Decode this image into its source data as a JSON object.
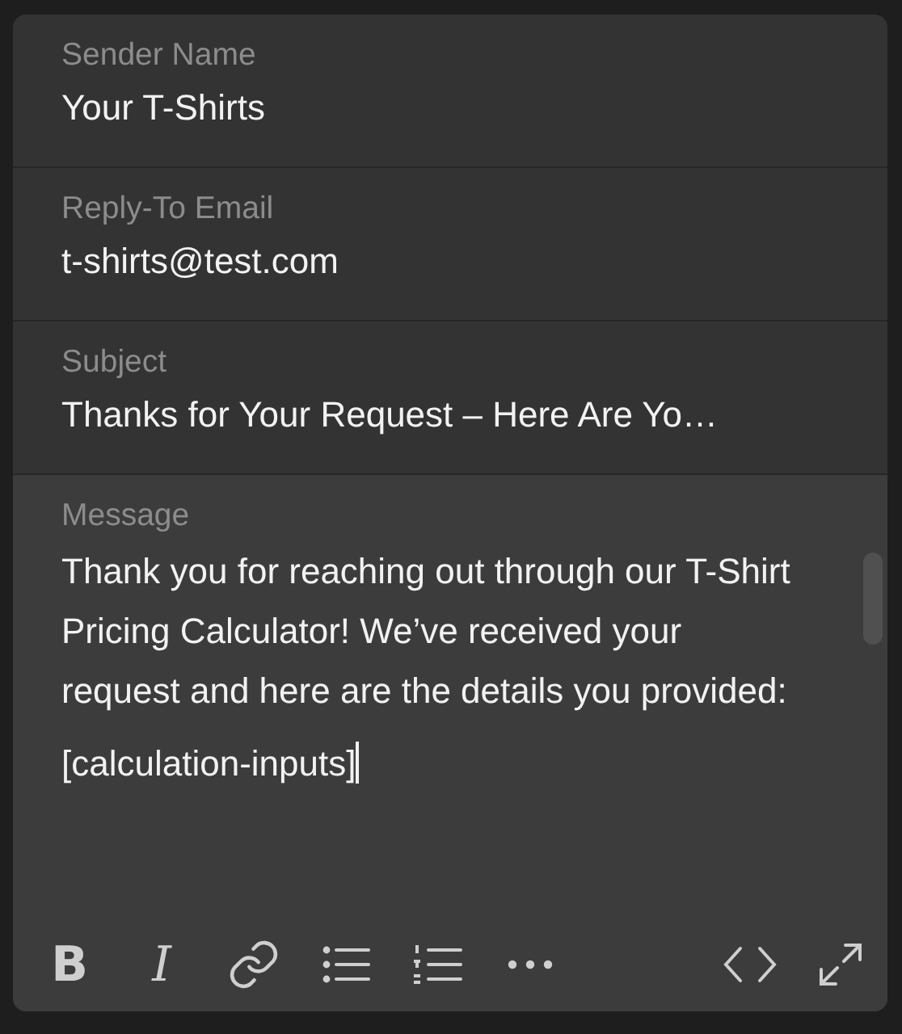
{
  "fields": [
    {
      "label": "Sender Name",
      "value": "Your T-Shirts"
    },
    {
      "label": "Reply-To Email",
      "value": "t-shirts@test.com"
    },
    {
      "label": "Subject",
      "value": "Thanks for Your Request – Here Are Yo…"
    }
  ],
  "message": {
    "label": "Message",
    "paragraphs": [
      "Thank you for reaching out through our T-Shirt Pricing Calculator! We’ve received your request and here are the details you provided:",
      "[calculation-inputs]"
    ]
  },
  "toolbar": {
    "left": [
      {
        "kind": "bold",
        "text": "B"
      },
      {
        "kind": "italic",
        "text": "I"
      },
      {
        "kind": "link"
      },
      {
        "kind": "bullets"
      },
      {
        "kind": "numbers"
      },
      {
        "kind": "more"
      }
    ],
    "right": [
      {
        "kind": "code"
      },
      {
        "kind": "expand"
      }
    ]
  }
}
